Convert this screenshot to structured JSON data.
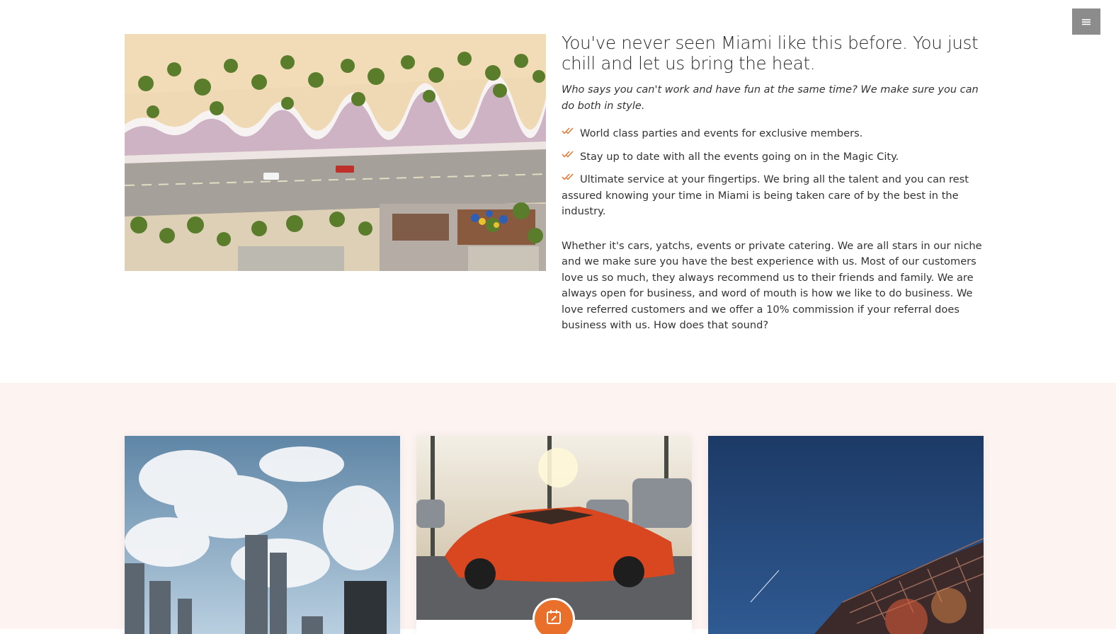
{
  "nav": {
    "menu_icon": "hamburger-menu-icon"
  },
  "about": {
    "image": {
      "alt": "Aerial view of Miami beach promenade with palm trees"
    },
    "headline": "You've never seen Miami like this before. You just chill and let us bring the heat.",
    "lead": "Who says you can't work and have fun at the same time? We make sure you can do both in style.",
    "features": [
      "World class parties and events for exclusive members.",
      "Stay up to date with all the events going on in the Magic City.",
      "Ultimate service at your fingertips. We bring all the talent and you can rest assured knowing your time in Miami is being taken care of by the best in the industry."
    ],
    "feature_icon": "double-check-icon",
    "body": "Whether it's cars, yatchs, events or private catering. We are all stars in our niche and we make sure you have the best experience with us. Most of our customers love us so much, they always recommend us to their friends and family. We are always open for business, and word of mouth is how we like to do business. We love referred customers and we offer a 10% commission if your referral does business with us. How does that sound?"
  },
  "cards": [
    {
      "image": "Miami skyline with clouds"
    },
    {
      "image": "Red sports car in parking lot at sunset",
      "icon": "calendar-edit-icon"
    },
    {
      "image": "Festival stage at night"
    }
  ],
  "colors": {
    "accent": "#e8702a",
    "section_bg": "#fdf4f1",
    "menu_button": "#8c8c8c"
  }
}
